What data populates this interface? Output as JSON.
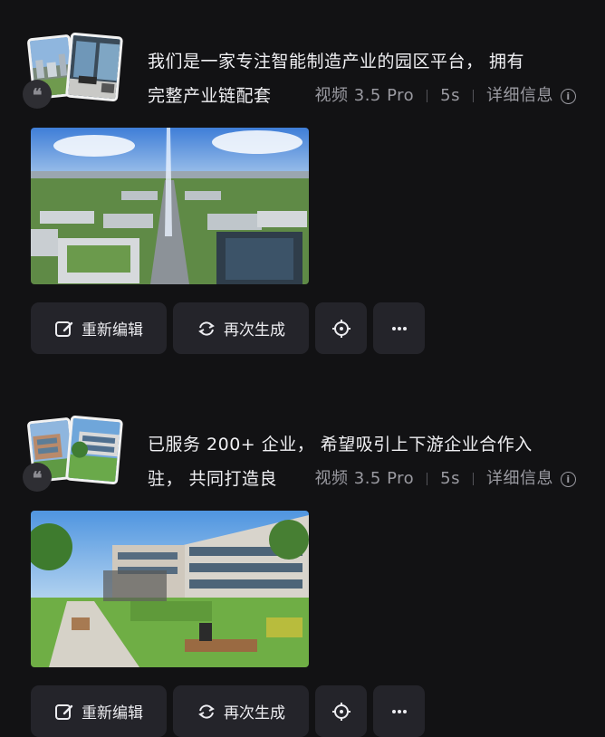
{
  "cards": [
    {
      "prompt_line1": "我们是一家专注智能制造产业的园区平台， 拥有",
      "prompt_line2": "完整产业链配套",
      "model": "视频 3.5 Pro",
      "duration": "5s",
      "details_label": "详细信息",
      "actions": {
        "edit_label": "重新编辑",
        "regenerate_label": "再次生成"
      }
    },
    {
      "prompt_line1": "已服务 200+ 企业， 希望吸引上下游企业合作入",
      "prompt_line2": "驻， 共同打造良",
      "model": "视频 3.5 Pro",
      "duration": "5s",
      "details_label": "详细信息",
      "actions": {
        "edit_label": "重新编辑",
        "regenerate_label": "再次生成"
      }
    }
  ],
  "colors": {
    "background": "#121214",
    "button_bg": "#24242a",
    "text": "#f0f0f3",
    "muted": "#9a9aa1"
  },
  "icons": [
    "quote-icon",
    "edit-icon",
    "regenerate-icon",
    "target-icon",
    "more-icon",
    "info-icon"
  ]
}
